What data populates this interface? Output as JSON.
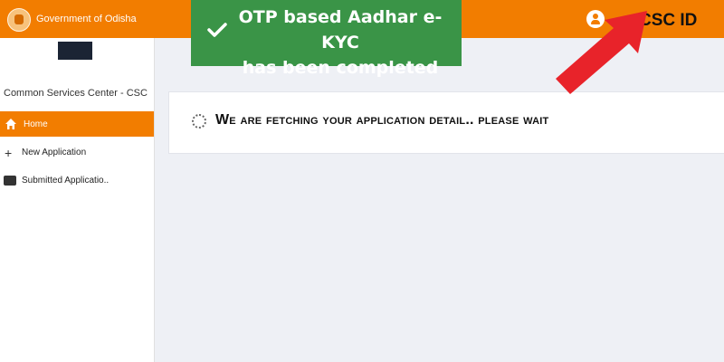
{
  "header": {
    "gov_name": "Government of Odisha",
    "csc_id_label": "CSC ID"
  },
  "toast": {
    "line1": "OTP based Aadhar e-KYC",
    "line2": "has been completed"
  },
  "sidebar": {
    "center_name": "Common Services Center - CSC",
    "items": [
      {
        "label": "Home",
        "icon": "home-icon",
        "active": true
      },
      {
        "label": "New Application",
        "icon": "plus-icon",
        "active": false
      },
      {
        "label": "Submitted Applicatio..",
        "icon": "box-icon",
        "active": false
      }
    ]
  },
  "main": {
    "status_message": "We are fetching your application detail.. please wait"
  },
  "colors": {
    "header_orange": "#f27d00",
    "toast_green": "#3a9447",
    "arrow_red": "#e8232a"
  }
}
